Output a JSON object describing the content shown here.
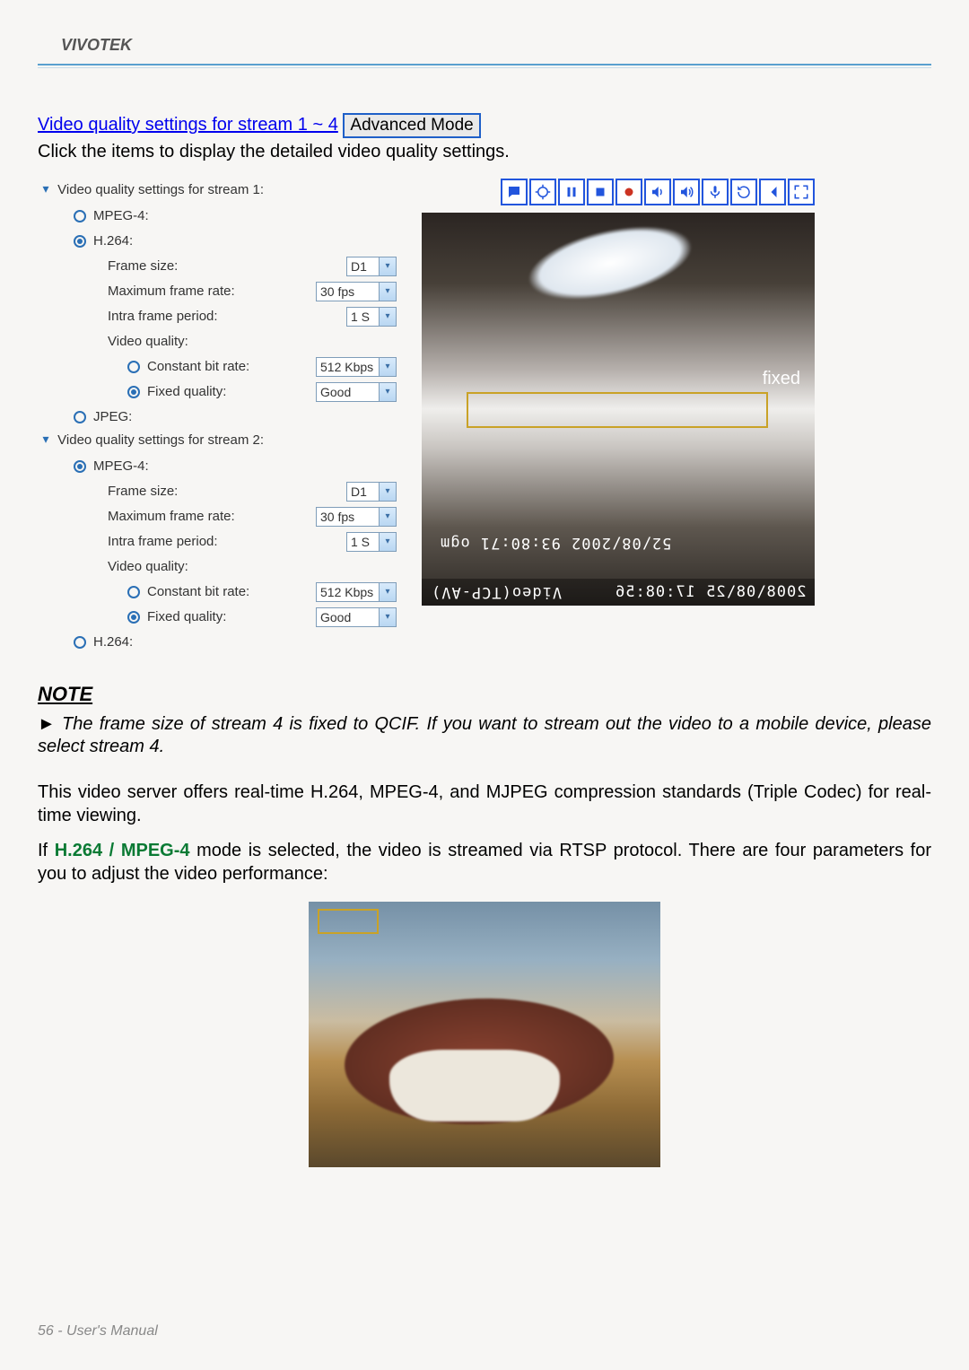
{
  "header": {
    "brand": "VIVOTEK"
  },
  "section": {
    "title_link": "Video quality settings for stream 1 ~ 4",
    "mode_badge": "Advanced Mode",
    "instruction": "Click the items to display the detailed video quality settings."
  },
  "streams": [
    {
      "header": "Video quality settings for stream 1:",
      "codecs": [
        {
          "label": "MPEG-4:",
          "selected": false
        },
        {
          "label": "H.264:",
          "selected": true,
          "params": {
            "frame_size": {
              "label": "Frame size:",
              "value": "D1"
            },
            "max_frame_rate": {
              "label": "Maximum frame rate:",
              "value": "30 fps"
            },
            "intra_frame_period": {
              "label": "Intra frame period:",
              "value": "1 S"
            },
            "video_quality_label": "Video quality:",
            "constant_bit_rate": {
              "label": "Constant bit rate:",
              "value": "512 Kbps",
              "selected": false
            },
            "fixed_quality": {
              "label": "Fixed quality:",
              "value": "Good",
              "selected": true
            }
          }
        },
        {
          "label": "JPEG:",
          "selected": false
        }
      ]
    },
    {
      "header": "Video quality settings for stream 2:",
      "codecs": [
        {
          "label": "MPEG-4:",
          "selected": true,
          "params": {
            "frame_size": {
              "label": "Frame size:",
              "value": "D1"
            },
            "max_frame_rate": {
              "label": "Maximum frame rate:",
              "value": "30 fps"
            },
            "intra_frame_period": {
              "label": "Intra frame period:",
              "value": "1 S"
            },
            "video_quality_label": "Video quality:",
            "constant_bit_rate": {
              "label": "Constant bit rate:",
              "value": "512 Kbps",
              "selected": false
            },
            "fixed_quality": {
              "label": "Fixed quality:",
              "value": "Good",
              "selected": true
            }
          }
        },
        {
          "label": "H.264:",
          "selected": false
        }
      ]
    }
  ],
  "video_panel": {
    "fixed_label": "fixed",
    "mid_overlay": "52/08/2002  93:80:71  ogm",
    "osd_left": "Video(TCP-AV)",
    "osd_right": "2008\\08\\25 17:08:56",
    "toolbar_icons": [
      "comment-icon",
      "target-icon",
      "pause-icon",
      "stop-icon",
      "record-icon",
      "volume-up-icon",
      "speaker-icon",
      "mic-icon",
      "reload-icon",
      "playback-icon",
      "fullscreen-icon"
    ]
  },
  "note": {
    "heading": "NOTE",
    "bullet": "► The frame size of stream 4 is fixed to QCIF. If you want to stream out the video to a mobile device, please select stream 4."
  },
  "paragraphs": {
    "p1": "This video server offers real-time H.264, MPEG-4, and MJPEG compression standards (Triple Codec) for real-time viewing.",
    "p2_pre": "If ",
    "p2_codec": "H.264 / MPEG-4",
    "p2_post": " mode is selected, the video is streamed via RTSP protocol. There are four parameters for you to adjust the video performance:"
  },
  "footer": {
    "page": "56 - User's Manual"
  }
}
